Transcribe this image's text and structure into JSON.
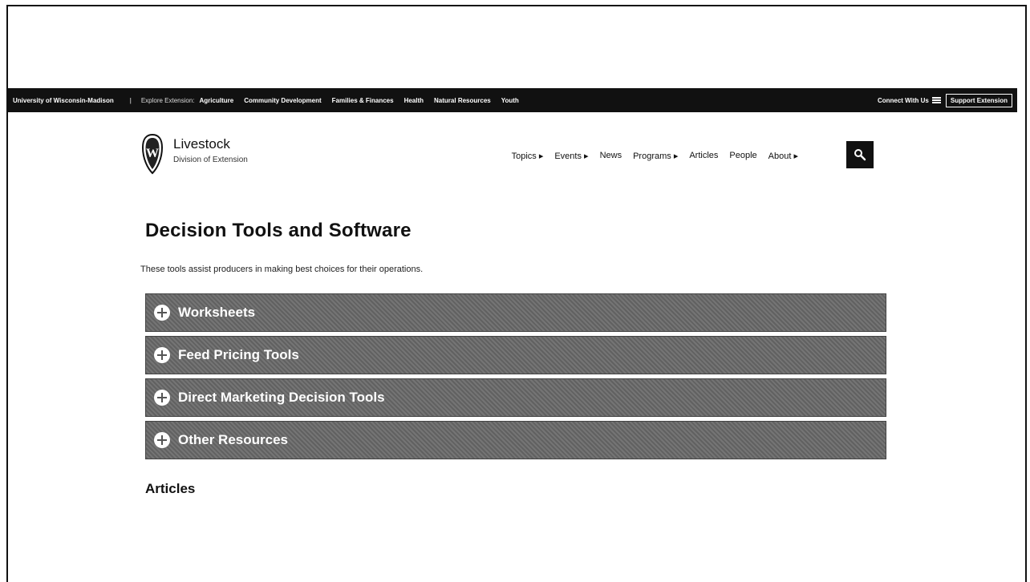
{
  "topbar": {
    "university": "University of Wisconsin-Madison",
    "separator": "|",
    "explore_label": "Explore Extension:",
    "categories": [
      "Agriculture",
      "Community Development",
      "Families & Finances",
      "Health",
      "Natural Resources",
      "Youth"
    ],
    "connect_label": "Connect With Us",
    "support_label": "Support Extension"
  },
  "header": {
    "site_title": "Livestock",
    "site_subtitle": "Division of Extension",
    "nav": [
      "Topics ▸",
      "Events ▸",
      "News",
      "Programs ▸",
      "Articles",
      "People",
      "About ▸"
    ],
    "search_icon": "search-icon"
  },
  "main": {
    "title": "Decision Tools and Software",
    "intro": "These tools assist producers in making best choices for their operations.",
    "accordion": [
      "Worksheets",
      "Feed Pricing Tools",
      "Direct Marketing Decision Tools",
      "Other Resources"
    ],
    "articles_heading": "Articles"
  },
  "colors": {
    "topbar_bg": "#111111",
    "accordion_bg": "#6c6c6c"
  }
}
